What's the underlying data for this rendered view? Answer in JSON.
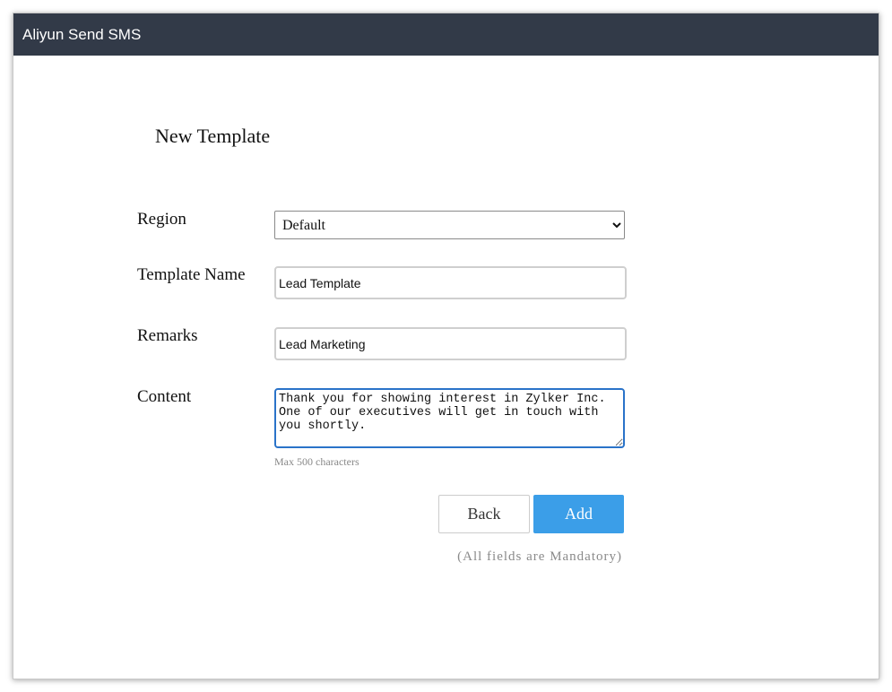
{
  "window": {
    "title": "Aliyun Send SMS"
  },
  "form": {
    "title": "New Template",
    "region": {
      "label": "Region",
      "selected": "Default"
    },
    "template_name": {
      "label": "Template Name",
      "value": "Lead Template"
    },
    "remarks": {
      "label": "Remarks",
      "value": "Lead Marketing"
    },
    "content": {
      "label": "Content",
      "value": "Thank you for showing interest in Zylker Inc. One of our executives will get in touch with you shortly.",
      "hint": "Max 500 characters"
    },
    "back_label": "Back",
    "add_label": "Add",
    "mandatory_note": "(All fields are Mandatory)"
  },
  "colors": {
    "titlebar_bg": "#323a48",
    "primary_button": "#3b9ee8",
    "focus_border": "#2a73c9"
  }
}
